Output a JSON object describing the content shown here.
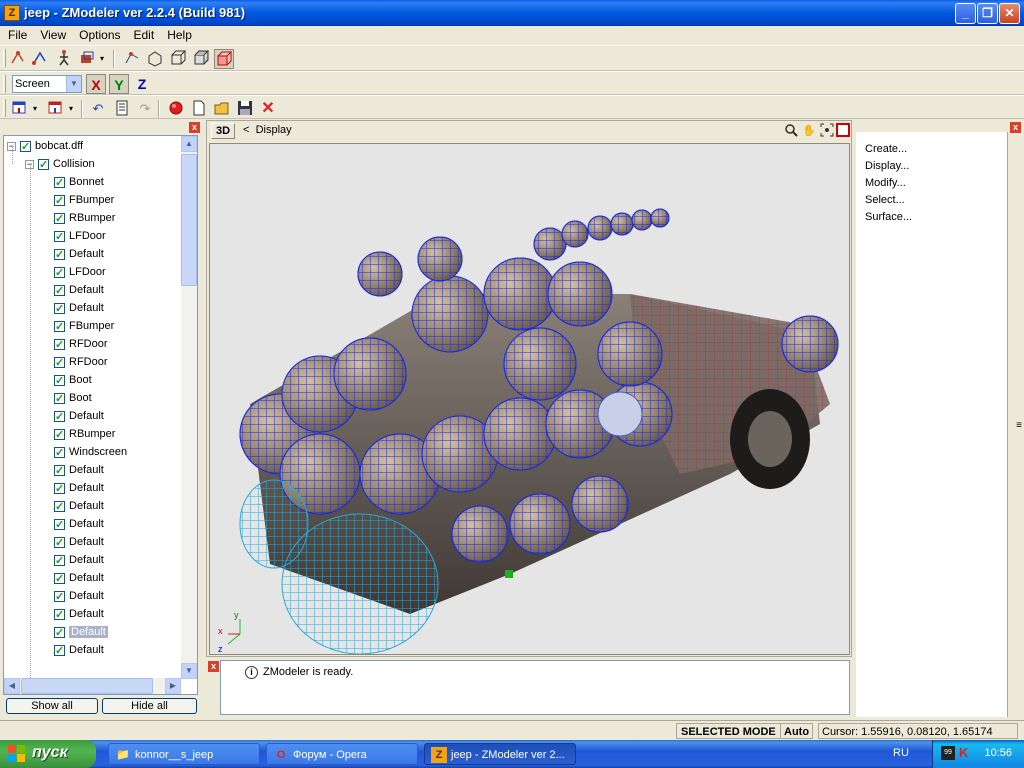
{
  "window": {
    "title": "jeep - ZModeler ver 2.2.4 (Build 981)",
    "app_icon": "Z",
    "controls": [
      "_",
      "❐",
      "✕"
    ]
  },
  "menu": [
    "File",
    "View",
    "Options",
    "Edit",
    "Help"
  ],
  "toolbar2": {
    "screen_select": "Screen",
    "axes": [
      "X",
      "Y",
      "Z"
    ],
    "axis_colors": {
      "X": "#c00000",
      "Y": "#008000",
      "Z": "#0000c0"
    }
  },
  "tree": {
    "root": "bobcat.dff",
    "group": "Collision",
    "items": [
      "Bonnet",
      "FBumper",
      "RBumper",
      "LFDoor",
      "Default",
      "LFDoor",
      "Default",
      "Default",
      "FBumper",
      "RFDoor",
      "RFDoor",
      "Boot",
      "Boot",
      "Default",
      "RBumper",
      "Windscreen",
      "Default",
      "Default",
      "Default",
      "Default",
      "Default",
      "Default",
      "Default",
      "Default",
      "Default",
      "Default",
      "Default"
    ],
    "selected_index": 25,
    "show_all": "Show all",
    "hide_all": "Hide all"
  },
  "viewport": {
    "mode": "3D",
    "label": "Display",
    "back": "<",
    "axis_labels": {
      "x": "x",
      "y": "y",
      "z": "z"
    }
  },
  "log": {
    "message": "ZModeler is ready."
  },
  "commands": [
    "Create...",
    "Display...",
    "Modify...",
    "Select...",
    "Surface..."
  ],
  "status": {
    "mode": "SELECTED MODE",
    "auto": "Auto",
    "cursor": "Cursor: 1.55916, 0.08120, 1.65174"
  },
  "taskbar": {
    "start": "пуск",
    "tasks": [
      "konnor__s_jeep",
      "Форум - Opera",
      "jeep - ZModeler ver 2..."
    ],
    "active_task": 2,
    "language": "RU",
    "clock": "10:56"
  }
}
